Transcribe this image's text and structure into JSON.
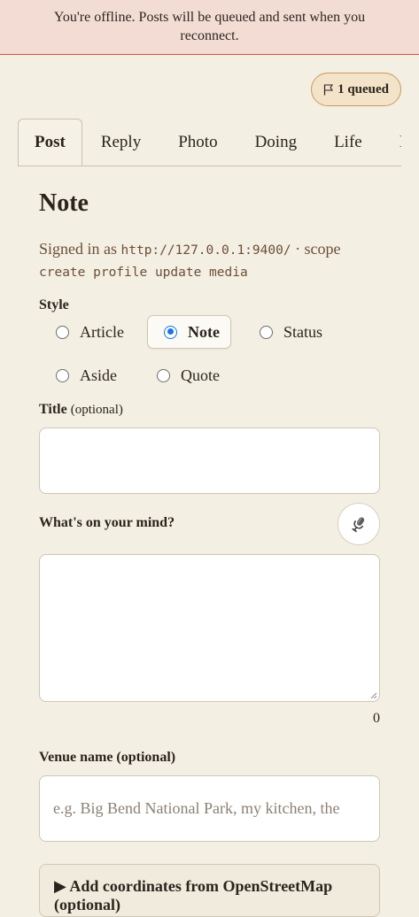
{
  "banner": {
    "offline_message": "You're offline. Posts will be queued and sent when you reconnect."
  },
  "queue": {
    "badge_label": "1 queued"
  },
  "tabs": [
    {
      "label": "Post",
      "active": true
    },
    {
      "label": "Reply",
      "active": false
    },
    {
      "label": "Photo",
      "active": false
    },
    {
      "label": "Doing",
      "active": false
    },
    {
      "label": "Life",
      "active": false
    },
    {
      "label": "I",
      "active": false
    }
  ],
  "form": {
    "heading": "Note",
    "signed_in_prefix": "Signed in as",
    "signed_in_url": "http://127.0.0.1:9400/",
    "scope_label": " · scope",
    "scope_values": "create profile update media",
    "style_label": "Style",
    "style_options": [
      {
        "label": "Article",
        "selected": false
      },
      {
        "label": "Note",
        "selected": true
      },
      {
        "label": "Status",
        "selected": false
      },
      {
        "label": "Aside",
        "selected": false
      },
      {
        "label": "Quote",
        "selected": false
      }
    ],
    "title_label": "Title",
    "title_optional": "(optional)",
    "title_value": "",
    "content_label": "What's on your mind?",
    "content_value": "",
    "char_count": "0",
    "venue_label": "Venue name (optional)",
    "venue_placeholder": "e.g. Big Bend National Park, my kitchen, the",
    "coords_summary": "▶ Add coordinates from OpenStreetMap (optional)"
  },
  "colors": {
    "background": "#f4efe3",
    "banner_bg": "#f2dcd4",
    "banner_border": "#c9584d",
    "badge_bg": "#f2e3c9",
    "badge_border": "#c99a5d",
    "accent": "#6b4f38",
    "radio_selected": "#1a73e8"
  },
  "icons": {
    "queue": "flag-icon",
    "dictation": "microphone-icon"
  }
}
